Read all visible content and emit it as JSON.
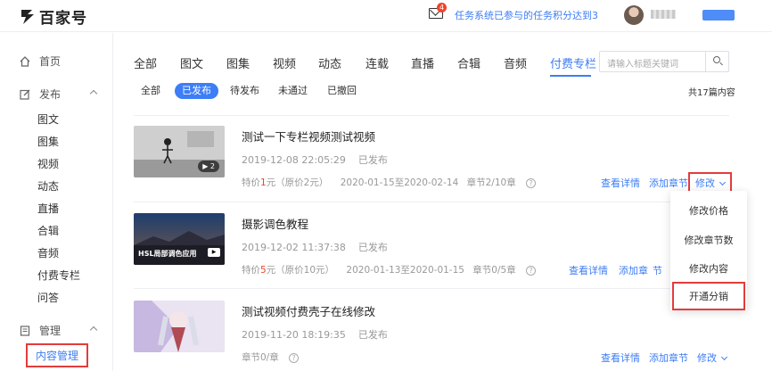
{
  "header": {
    "logo_text": "百家号",
    "mail_badge": "4",
    "notice": "任务系统已参与的任务积分达到3..."
  },
  "sidebar": {
    "home": "首页",
    "publish": "发布",
    "publish_items": [
      "图文",
      "图集",
      "视频",
      "动态",
      "直播",
      "合辑",
      "音频",
      "付费专栏",
      "问答"
    ],
    "manage": "管理",
    "content_manage": "内容管理"
  },
  "tabs": [
    "全部",
    "图文",
    "图集",
    "视频",
    "动态",
    "连载",
    "直播",
    "合辑",
    "音频",
    "付费专栏"
  ],
  "search": {
    "placeholder": "请输入标题关键词"
  },
  "filters": [
    "全部",
    "已发布",
    "待发布",
    "未通过",
    "已撤回"
  ],
  "total": "共17篇内容",
  "items": [
    {
      "title": "测试一下专栏视频测试视频",
      "time": "2019-12-08 22:05:29",
      "status": "已发布",
      "price_prefix": "特价",
      "price": "1",
      "price_suffix": "元（原价2元）",
      "period": "2020-01-15至2020-02-14",
      "chapters": "章节2/10章",
      "thumb_badge": "2",
      "actions": [
        "查看详情",
        "添加章节",
        "修改"
      ]
    },
    {
      "title": "摄影调色教程",
      "time": "2019-12-02 11:37:38",
      "status": "已发布",
      "price_prefix": "特价",
      "price": "5",
      "price_suffix": "元（原价10元）",
      "period": "2020-01-13至2020-01-15",
      "chapters": "章节0/5章",
      "thumb_text": "HSL局部调色应用",
      "actions": [
        "查看详情",
        "添加章",
        "节"
      ]
    },
    {
      "title": "测试视频付费壳子在线修改",
      "time": "2019-11-20 18:19:35",
      "status": "已发布",
      "chapters": "章节0/章",
      "actions": [
        "查看详情",
        "添加章节",
        "修改"
      ]
    }
  ],
  "dropdown": [
    "修改价格",
    "修改章节数",
    "修改内容",
    "开通分销"
  ],
  "colors": {
    "accent": "#3d7df5",
    "highlight_box": "#e23c3c",
    "price": "#f2432c"
  }
}
